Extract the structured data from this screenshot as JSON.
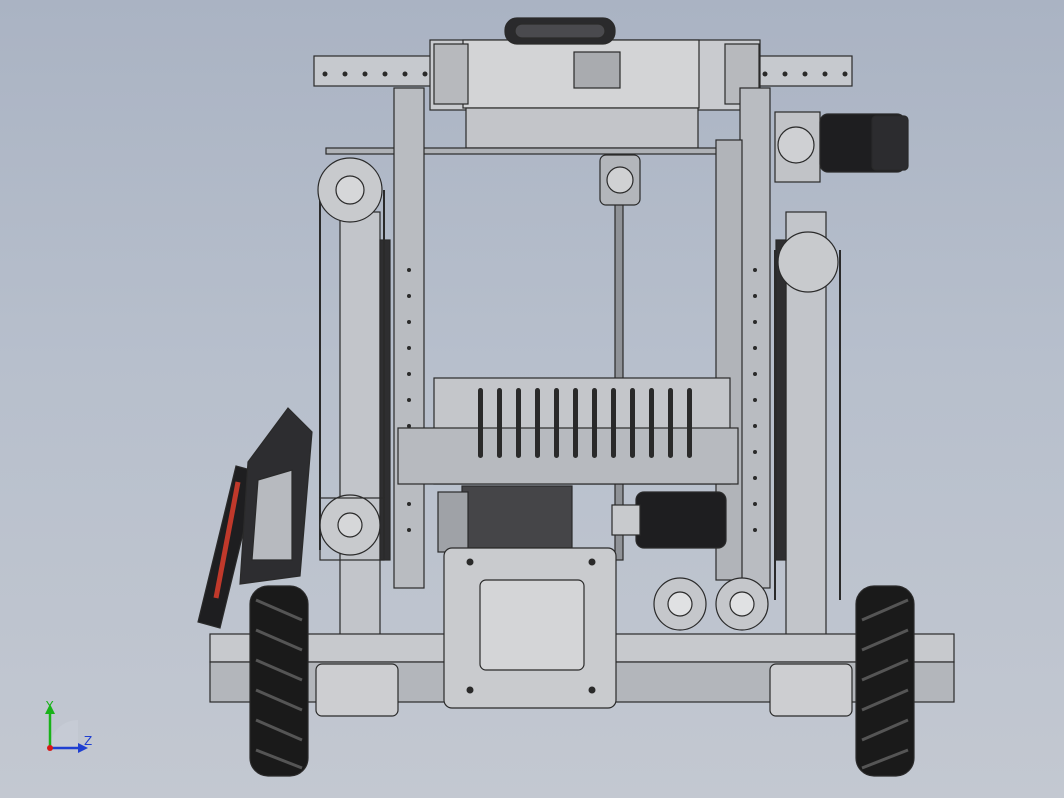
{
  "view": {
    "background_top": "#aab3c3",
    "background_bottom": "#c3c8d1"
  },
  "palette": {
    "frame": "#bfc2c8",
    "frame_dark": "#9ea3ab",
    "motor_black": "#1e1e20",
    "wheel_black": "#1a1a1a",
    "accent_red": "#c0392b",
    "edge": "#2a2a2a"
  },
  "triad": {
    "y_label": "Y",
    "z_label": "Z",
    "y_color": "#19b219",
    "z_color": "#1f3fd1",
    "origin_color": "#d81818"
  }
}
